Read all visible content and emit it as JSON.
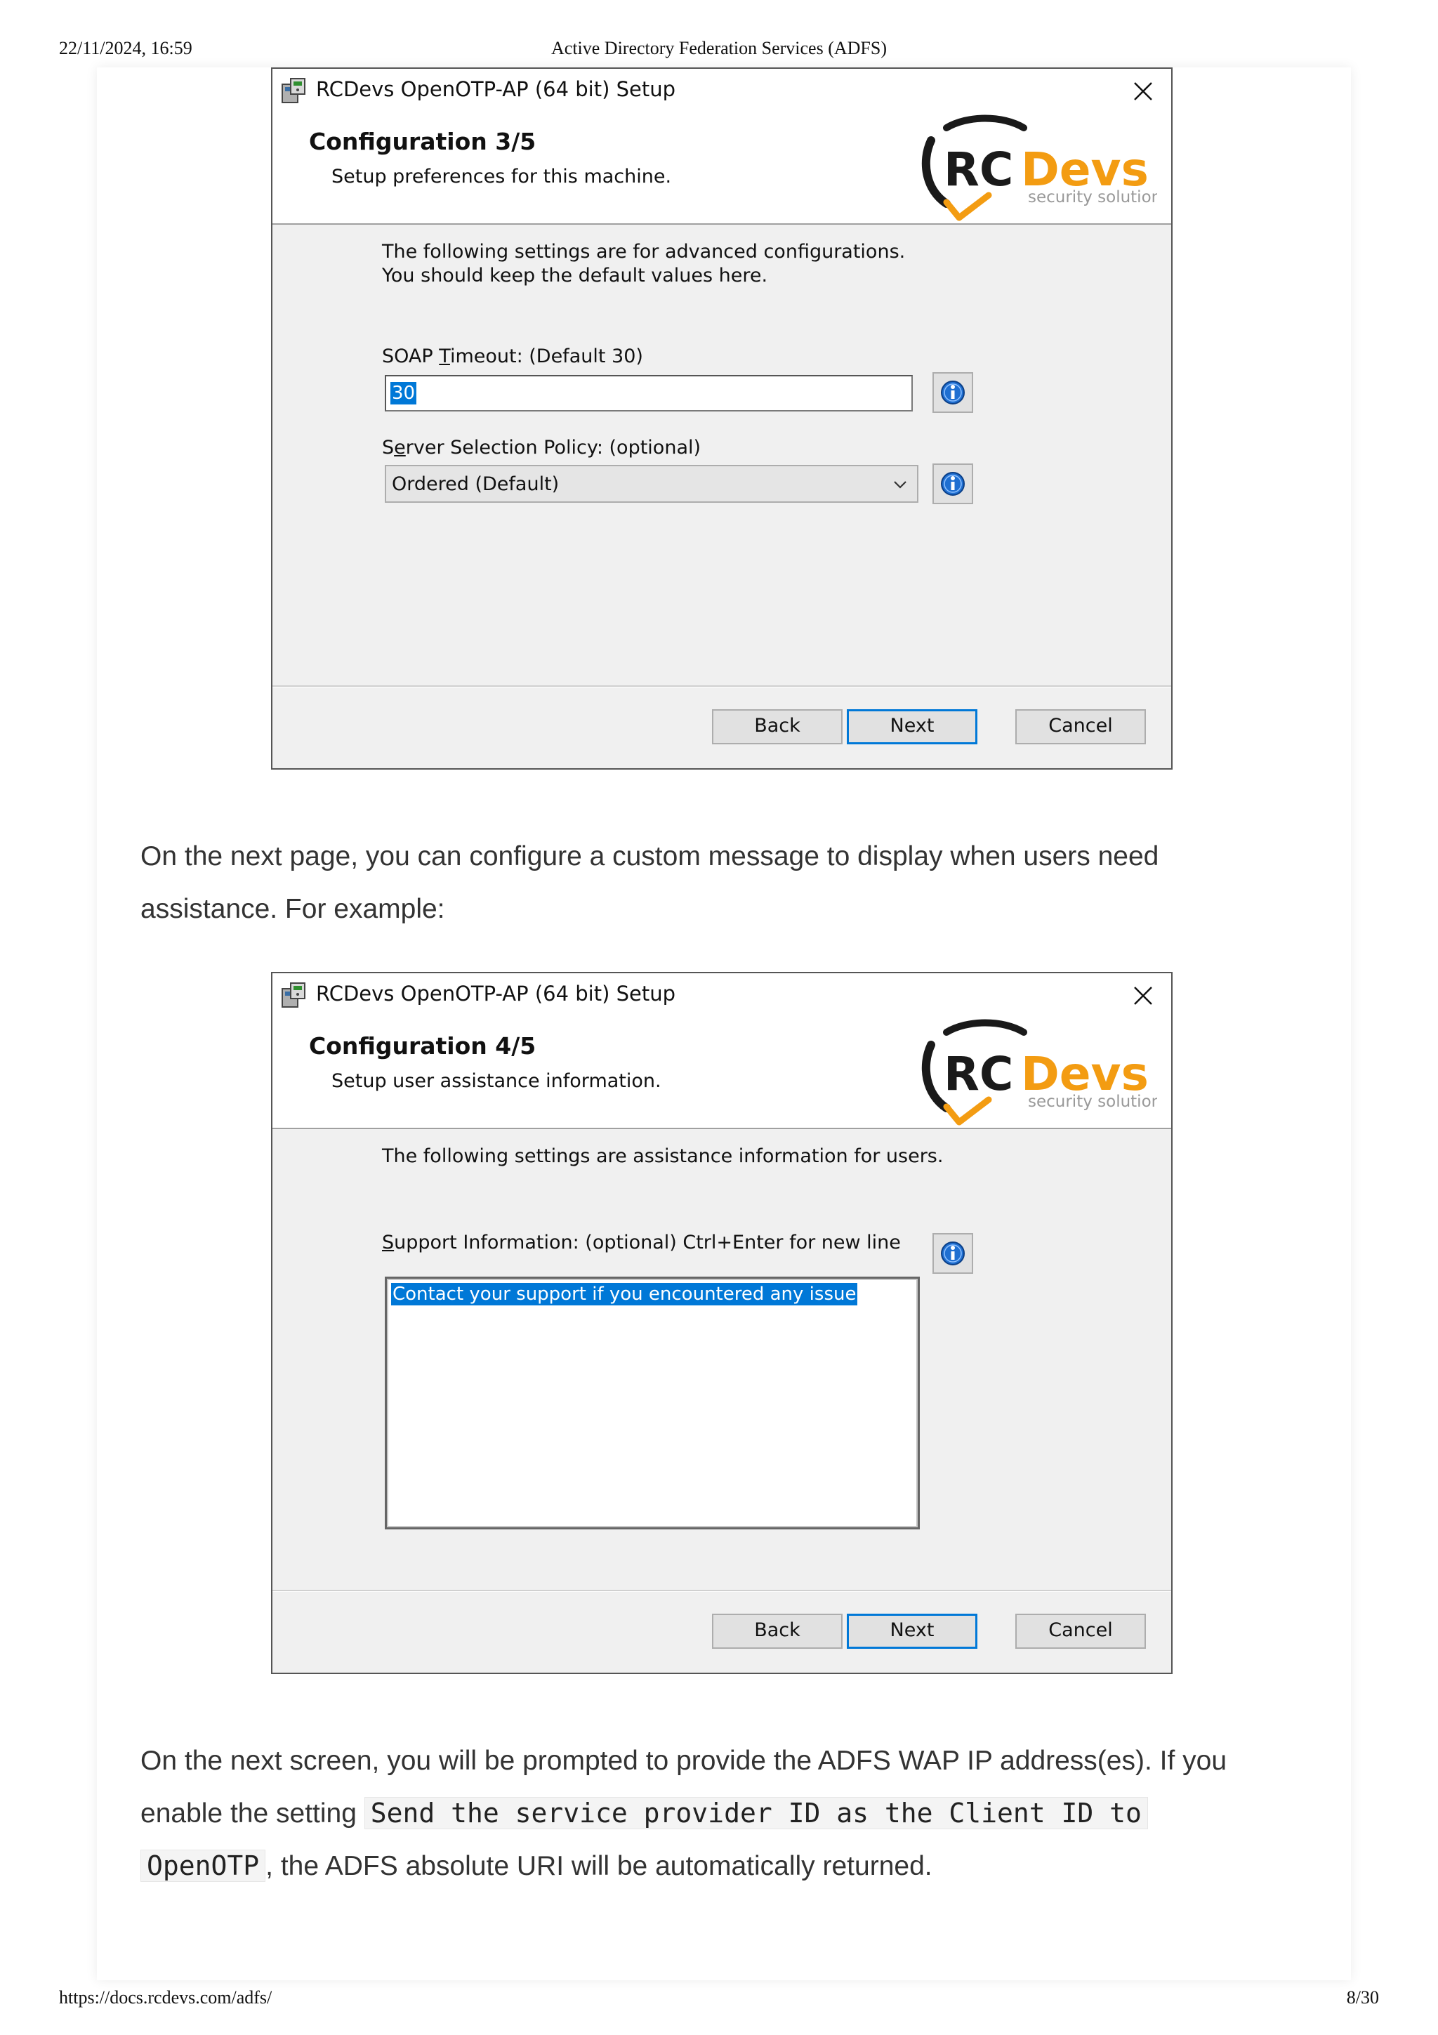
{
  "print_header": {
    "datetime": "22/11/2024, 16:59",
    "title": "Active Directory Federation Services (ADFS)"
  },
  "print_footer": {
    "url": "https://docs.rcdevs.com/adfs/",
    "page": "8/30"
  },
  "logo": {
    "text_rc": "RC",
    "text_devs": "Devs",
    "tagline": "security solutions",
    "colors": {
      "dark": "#1a1a1a",
      "orange": "#f39c12",
      "tag": "#999999"
    }
  },
  "dialog1": {
    "window_title": "RCDevs OpenOTP-AP (64 bit) Setup",
    "step_title": "Configuration 3/5",
    "step_subtitle": "Setup preferences for this machine.",
    "intro_line1": "The following settings are for advanced configurations.",
    "intro_line2": "You should keep the default values here.",
    "soap": {
      "pre": "SOAP ",
      "accel": "T",
      "post": "imeout: (Default 30)",
      "value": "30"
    },
    "policy": {
      "pre": "S",
      "accel": "e",
      "post": "rver Selection Policy: (optional)",
      "selected": "Ordered (Default)"
    },
    "buttons": {
      "back": "Back",
      "next": "Next",
      "cancel": "Cancel"
    }
  },
  "para1": {
    "line1": "On the next page, you can configure a custom message to display when users need",
    "line2": "assistance. For example:"
  },
  "dialog2": {
    "window_title": "RCDevs OpenOTP-AP (64 bit) Setup",
    "step_title": "Configuration 4/5",
    "step_subtitle": "Setup user assistance information.",
    "intro_line1": "The following settings are assistance information for users.",
    "support": {
      "accel": "S",
      "post": "upport Information: (optional) Ctrl+Enter for new line",
      "value": "Contact your support if you encountered any issue"
    },
    "buttons": {
      "back": "Back",
      "next": "Next",
      "cancel": "Cancel"
    }
  },
  "para2": {
    "line1": "On the next screen, you will be prompted to provide the ADFS WAP IP address(es). If you",
    "line2_pre": "enable the setting ",
    "code1": "Send the service provider ID as the Client ID to",
    "code2": "OpenOTP",
    "line3_post": ", the ADFS absolute URI will be automatically returned."
  }
}
